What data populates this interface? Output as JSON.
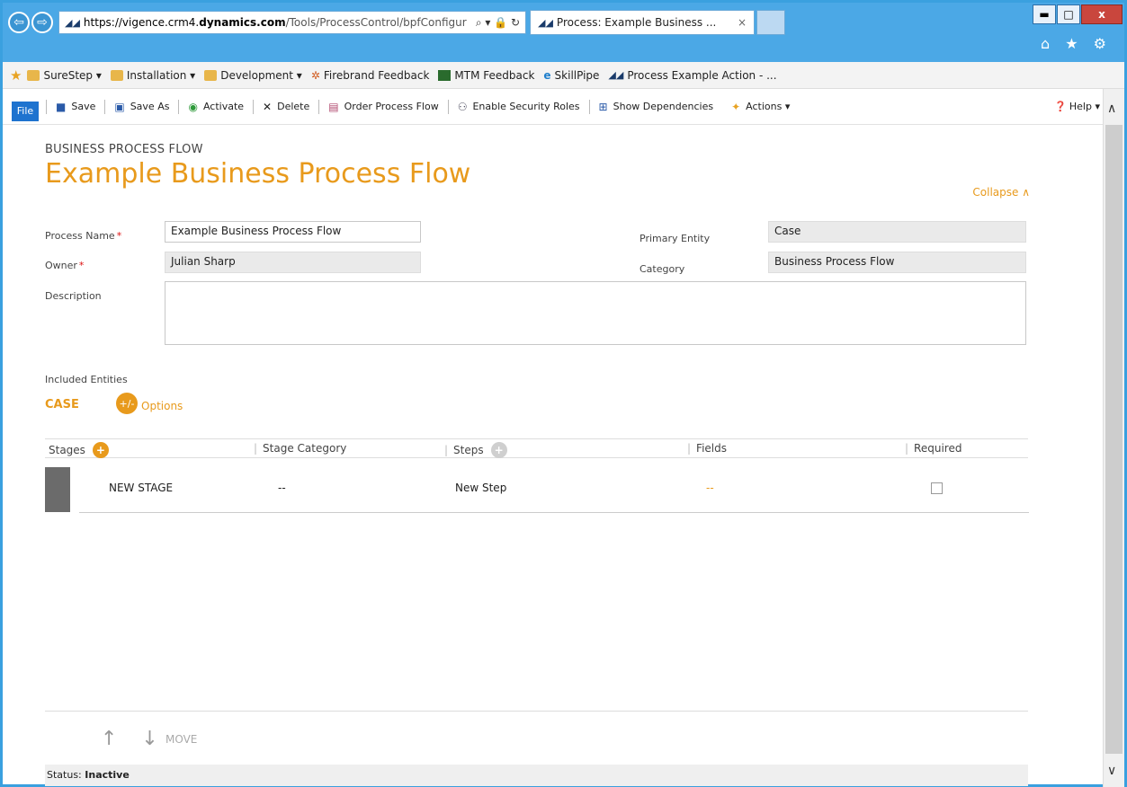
{
  "window": {
    "controls": [
      "▬",
      "□",
      "x"
    ]
  },
  "browser": {
    "url_prefix": "https://vigence.crm4.",
    "url_host": "dynamics.com",
    "url_path": "/Tools/ProcessControl/bpfConfigur",
    "url_tools": "⌕ ▾ 🔒 ↻",
    "tab_title": "Process: Example Business ...",
    "tab_close": "×",
    "right_icons": "⌂ ★ ⚙"
  },
  "favorites": [
    {
      "label": "SureStep ▾",
      "icon": "folder-icon"
    },
    {
      "label": "Installation ▾",
      "icon": "folder-icon"
    },
    {
      "label": "Development ▾",
      "icon": "folder-icon"
    },
    {
      "label": "Firebrand Feedback",
      "icon": "gear-icon"
    },
    {
      "label": "MTM Feedback",
      "icon": "chart-icon"
    },
    {
      "label": "SkillPipe",
      "icon": "ie-icon"
    },
    {
      "label": "Process Example Action - ...",
      "icon": "dynamics-icon"
    }
  ],
  "commandbar": {
    "file": "File",
    "save": "Save",
    "save_as": "Save As",
    "activate": "Activate",
    "delete": "Delete",
    "order_process_flow": "Order Process Flow",
    "enable_security_roles": "Enable Security Roles",
    "show_dependencies": "Show Dependencies",
    "actions": "Actions ▾",
    "help": "Help ▾"
  },
  "header": {
    "subtitle": "BUSINESS PROCESS FLOW",
    "title": "Example Business Process Flow",
    "collapse": "Collapse ∧"
  },
  "form": {
    "process_name_label": "Process Name",
    "process_name_value": "Example Business Process Flow",
    "owner_label": "Owner",
    "owner_value": "Julian Sharp",
    "description_label": "Description",
    "description_value": "",
    "primary_entity_label": "Primary Entity",
    "primary_entity_value": "Case",
    "category_label": "Category",
    "category_value": "Business Process Flow",
    "required_mark": "*"
  },
  "entities": {
    "label": "Included Entities",
    "current": "CASE",
    "options_icon": "+/-",
    "options_label": "Options"
  },
  "stages_table": {
    "headers": {
      "stages": "Stages",
      "stage_category": "Stage Category",
      "steps": "Steps",
      "fields": "Fields",
      "required": "Required"
    },
    "rows": [
      {
        "stage": "NEW STAGE",
        "category": "--",
        "step": "New Step",
        "fields": "--",
        "required": false
      }
    ]
  },
  "move": {
    "arrows": "↑ ↓",
    "label": "MOVE"
  },
  "status": {
    "label": "Status:",
    "value": "Inactive"
  }
}
